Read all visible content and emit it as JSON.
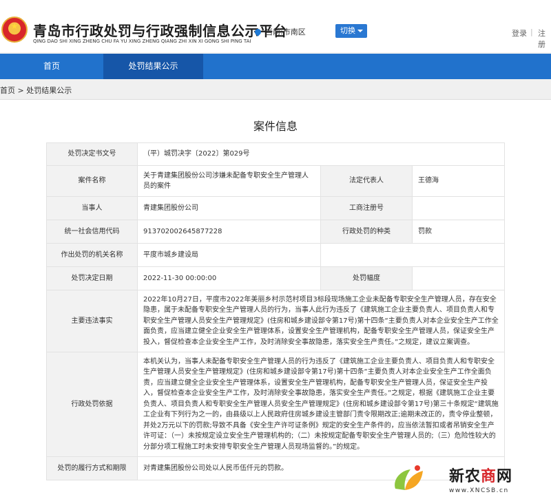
{
  "header": {
    "title": "青岛市行政处罚与行政强制信息公示平台",
    "pinyin": "QING DAO SHI XING ZHENG CHU FA YU XING ZHENG QIANG ZHI XIN XI GONG SHI PING TAI",
    "location": "当前:市南区",
    "switch_label": "切换",
    "login": "登录",
    "separator": "|",
    "register": "注册"
  },
  "nav": {
    "items": [
      {
        "label": "首页"
      },
      {
        "label": "处罚结果公示"
      }
    ]
  },
  "breadcrumb": {
    "home": "首页",
    "separator": " > ",
    "current": "处罚结果公示"
  },
  "panel": {
    "title": "案件信息"
  },
  "case": {
    "decision_no_label": "处罚决定书文号",
    "decision_no": "（平）城罚决字〔2022〕第029号",
    "case_name_label": "案件名称",
    "case_name": "关于青建集团股份公司涉嫌未配备专职安全生产管理人员的案件",
    "legal_rep_label": "法定代表人",
    "legal_rep": "王德海",
    "party_label": "当事人",
    "party": "青建集团股份公司",
    "biz_reg_label": "工商注册号",
    "biz_reg": "",
    "credit_code_label": "统一社会信用代码",
    "credit_code": "913702002645877228",
    "penalty_type_label": "行政处罚的种类",
    "penalty_type": "罚款",
    "authority_label": "作出处罚的机关名称",
    "authority": "平度市城乡建设局",
    "decision_date_label": "处罚决定日期",
    "decision_date": "2022-11-30 00:00:00",
    "penalty_range_label": "处罚幅度",
    "penalty_range": "",
    "facts_label": "主要违法事实",
    "facts": "2022年10月27日，平度市2022年美丽乡村示范村项目3标段现场施工企业未配备专职安全生产管理人员，存在安全隐患，属于未配备专职安全生产管理人员的行为，当事人此行为违反了《建筑施工企业主要负责人、项目负责人和专职安全生产管理人员安全生产管理规定》(住房和城乡建设部令第17号)第十四条“主要负责人对本企业安全生产工作全面负责，应当建立健全企业安全生产管理体系，设置安全生产管理机构，配备专职安全生产管理人员，保证安全生产投入，督促检查本企业安全生产工作，及时消除安全事故隐患，落实安全生产责任。”之规定，建议立案调查。",
    "basis_label": "行政处罚依据",
    "basis": "本机关认为，当事人未配备专职安全生产管理人员的行为违反了《建筑施工企业主要负责人、项目负责人和专职安全生产管理人员安全生产管理规定》(住房和城乡建设部令第17号)第十四条“主要负责人对本企业安全生产工作全面负责，应当建立健全企业安全生产管理体系，设置安全生产管理机构，配备专职安全生产管理人员，保证安全生产投入，督促检查本企业安全生产工作，及时消除安全事故隐患，落实安全生产责任。”之规定，根据《建筑施工企业主要负责人、项目负责人和专职安全生产管理人员安全生产管理规定》(住房和城乡建设部令第17号)第三十条规定“建筑施工企业有下列行为之一的，由县级以上人民政府住房城乡建设主管部门责令限期改正;逾期未改正的，责令停业整顿，并处2万元以下的罚款;导致不具备《安全生产许可证条例》规定的安全生产条件的，应当依法暂扣或者吊销安全生产许可证：（一）未按规定设立安全生产管理机构的;（二）未按规定配备专职安全生产管理人员的;（三）危险性较大的分部分项工程施工时未安排专职安全生产管理人员现场监督的。”的规定。",
    "performance_label": "处罚的履行方式和期限",
    "performance": "对青建集团股份公司处以人民币伍仟元的罚款。"
  },
  "watermark": {
    "name_left": "新农",
    "name_accent": "商",
    "name_right": "网",
    "url": "www.XNCSB.cn"
  }
}
